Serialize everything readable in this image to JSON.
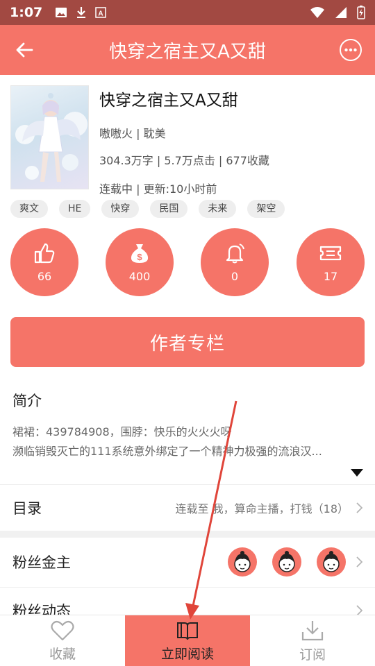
{
  "status_bar": {
    "time": "1:07",
    "icons": [
      "image-icon",
      "download-icon",
      "text-a-icon",
      "wifi-icon",
      "signal-icon",
      "battery-charging-icon"
    ]
  },
  "header": {
    "title": "快穿之宿主又A又甜",
    "back_icon": "back-arrow-icon",
    "more_icon": "more-options-icon"
  },
  "book": {
    "title": "快穿之宿主又A又甜",
    "author_line": "嗷嗷火 | 耽美",
    "stats_line": "304.3万字 | 5.7万点击 | 677收藏",
    "status_line": "连载中 | 更新:10小时前"
  },
  "tags": [
    "爽文",
    "HE",
    "快穿",
    "民国",
    "未来",
    "架空"
  ],
  "actions": {
    "like": {
      "icon": "thumbs-up-icon",
      "count": "66"
    },
    "reward": {
      "icon": "money-bag-icon",
      "count": "400"
    },
    "remind": {
      "icon": "bell-icon",
      "count": "0"
    },
    "ticket": {
      "icon": "ticket-icon",
      "count": "17"
    }
  },
  "author_button": "作者专栏",
  "intro": {
    "heading": "简介",
    "line1": "裙裙：439784908，围脖：快乐的火火火呀",
    "line2": "濒临销毁灭亡的111系统意外绑定了一个精神力极强的流浪汉..."
  },
  "catalog": {
    "label": "目录",
    "latest": "连载至 我，算命主播，打钱（18）"
  },
  "fans": {
    "label": "粉丝金主",
    "count_avatars": 3
  },
  "fan_activity": {
    "label": "粉丝动态"
  },
  "bottom_nav": {
    "favorite": "收藏",
    "read": "立即阅读",
    "subscribe": "订阅"
  },
  "colors": {
    "accent": "#f57468",
    "status_bar": "#a24942",
    "annotation_arrow": "#e0453a"
  }
}
